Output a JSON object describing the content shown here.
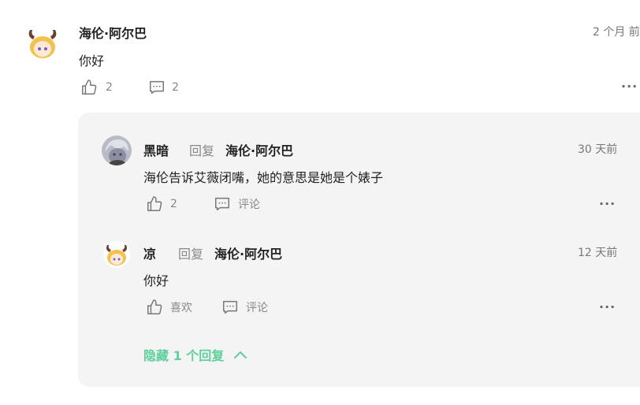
{
  "colors": {
    "accent": "#5fcf9c",
    "panel_bg": "#f4f4f5",
    "muted": "#888888"
  },
  "comment": {
    "author": "海伦·阿尔巴",
    "time": "2 个月 前",
    "text": "你好",
    "likes": "2",
    "replies_count": "2",
    "like_icon": "thumbs-up-icon",
    "reply_icon": "comment-icon",
    "more_icon": "more-icon"
  },
  "replies": [
    {
      "author": "黑暗",
      "reply_word": "回复",
      "reply_to": "海伦·阿尔巴",
      "time": "30 天前",
      "text": "海伦告诉艾薇闭嘴，她的意思是她是个婊子",
      "likes": "2",
      "reply_label": "评论"
    },
    {
      "author": "凉",
      "reply_word": "回复",
      "reply_to": "海伦·阿尔巴",
      "time": "12 天前",
      "text": "你好",
      "like_label": "喜欢",
      "reply_label": "评论"
    }
  ],
  "hide_replies_label": "隐藏 1 个回复",
  "more_glyph": "···"
}
